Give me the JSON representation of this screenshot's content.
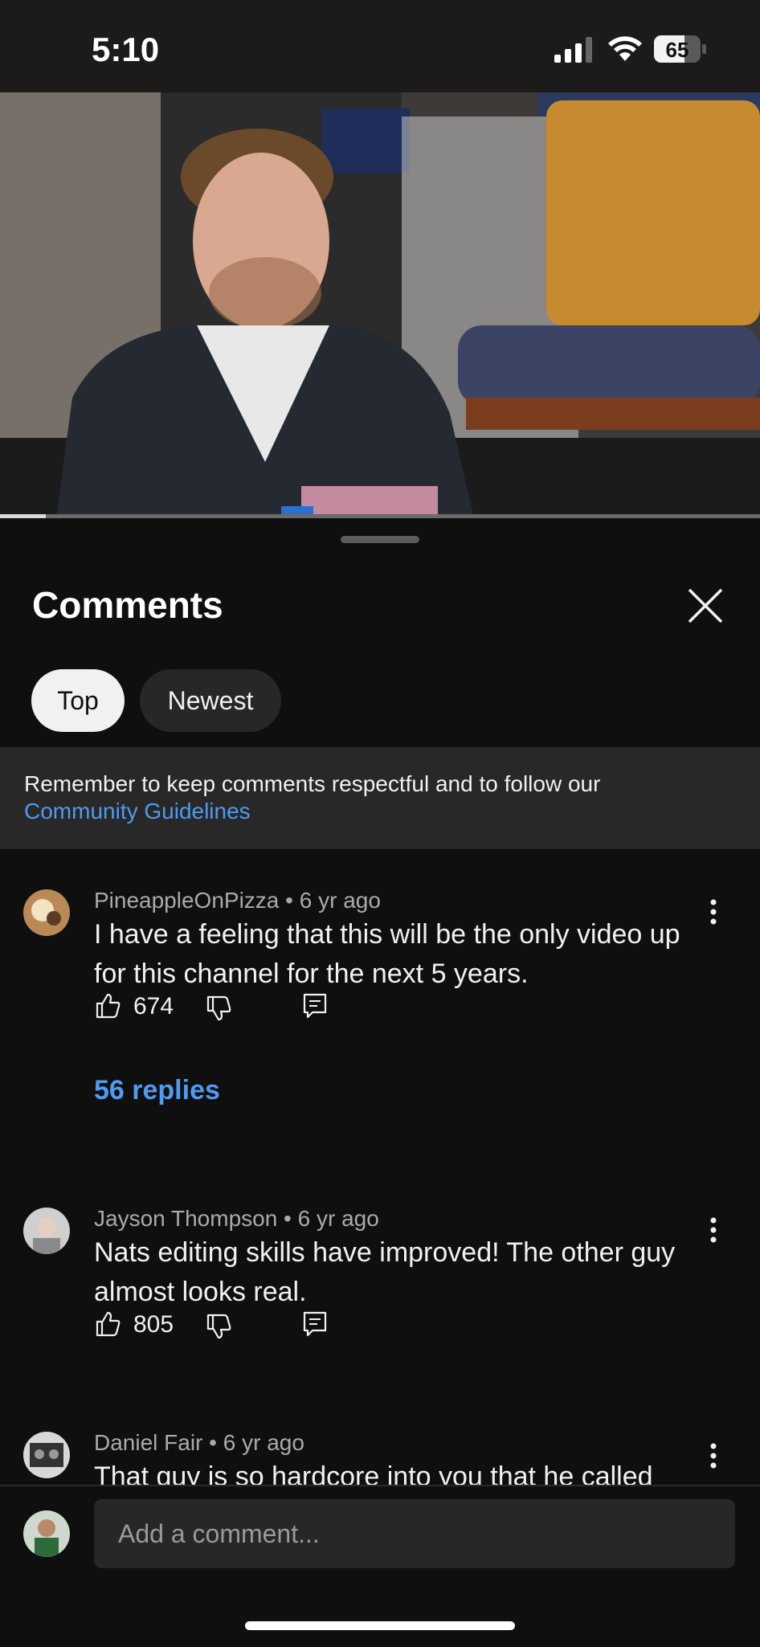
{
  "status": {
    "time": "5:10",
    "battery": "65",
    "battery_level": 0.65
  },
  "video": {
    "progress": 0.06
  },
  "sheet": {
    "title": "Comments",
    "chips": [
      {
        "label": "Top",
        "selected": true
      },
      {
        "label": "Newest",
        "selected": false
      }
    ],
    "notice": {
      "text": "Remember to keep comments respectful and to follow our",
      "link": "Community Guidelines"
    }
  },
  "comments": [
    {
      "author": "PineappleOnPizza",
      "time": "6 yr ago",
      "meta": "PineappleOnPizza • 6 yr ago",
      "text": "I have a feeling that this will be the only video up for this channel for the next 5 years.",
      "likes": "674",
      "replies": "56 replies"
    },
    {
      "author": "Jayson Thompson",
      "time": "6 yr ago",
      "meta": "Jayson Thompson • 6 yr ago",
      "text": "Nats editing skills have improved! The other guy almost looks real.",
      "likes": "805"
    },
    {
      "author": "Daniel Fair",
      "time": "6 yr ago",
      "meta": "Daniel Fair • 6 yr ago",
      "text": "That guy is so hardcore into you that he called"
    }
  ],
  "composer": {
    "placeholder": "Add a comment..."
  },
  "colors": {
    "accent": "#4f9bf0",
    "background": "#0f0f0f",
    "chip_selected": "#f1f1f1"
  },
  "icons": [
    "signal-icon",
    "wifi-icon",
    "battery-icon",
    "close-icon",
    "like-icon",
    "dislike-icon",
    "reply-icon",
    "more-vert-icon"
  ]
}
